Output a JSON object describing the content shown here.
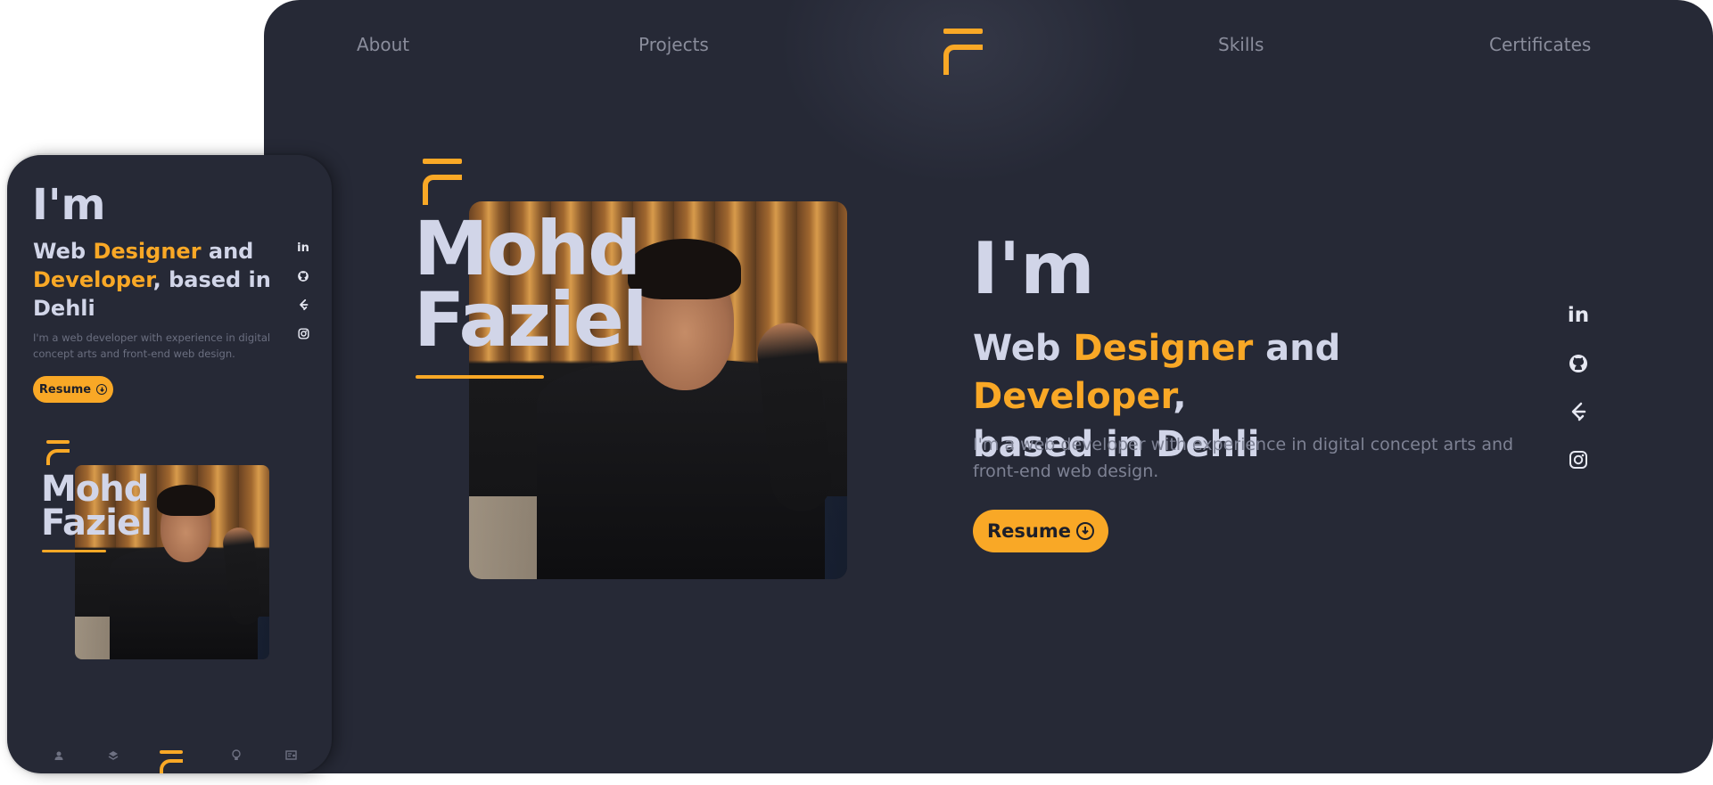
{
  "nav": {
    "links": [
      "About",
      "Projects",
      "Skills",
      "Certificates"
    ]
  },
  "profile": {
    "name_line1": "Mohd",
    "name_line2": "Faziel"
  },
  "hero": {
    "intro": "I'm",
    "headline": {
      "w1": "Web ",
      "w2": "Designer",
      "w3": " and ",
      "w4": "Developer",
      "w5": ",",
      "w6": "based in Dehli"
    },
    "mobile_headline": {
      "w1": "Web ",
      "w2": "Designer",
      "w3": " and",
      "w4": "Developer",
      "w5": ", based in",
      "w6": "Dehli"
    },
    "description": "I'm a web developer with experience in digital concept arts and front-end web design.",
    "resume_label": "Resume"
  },
  "social": {
    "linkedin_label": "in",
    "icons": [
      "linkedin-icon",
      "github-icon",
      "leetcode-icon",
      "instagram-icon"
    ]
  },
  "mobile_nav": {
    "icons": [
      "user-icon",
      "layers-icon",
      "logo-icon",
      "lightbulb-icon",
      "certificate-icon"
    ]
  },
  "colors": {
    "background": "#262936",
    "accent": "#f9a826",
    "text_primary": "#d1d5e8",
    "text_muted": "#7e8294"
  }
}
